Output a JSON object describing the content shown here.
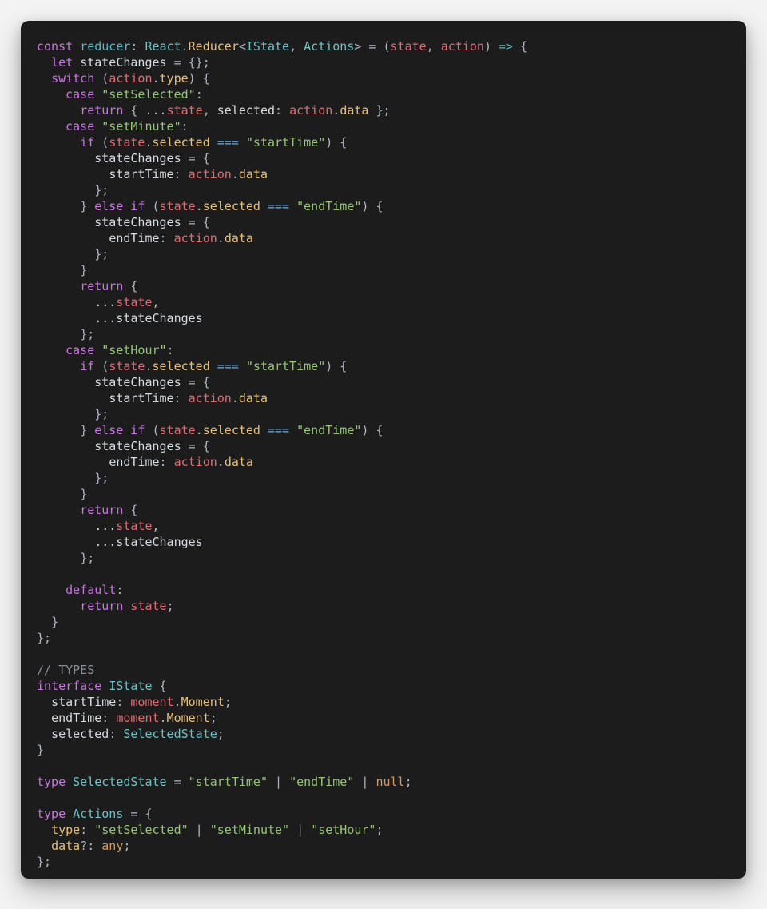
{
  "code": {
    "tokens": [
      [
        [
          "kw",
          "const"
        ],
        [
          "id",
          " "
        ],
        [
          "fn",
          "reducer"
        ],
        [
          "punc",
          ": "
        ],
        [
          "ty",
          "React"
        ],
        [
          "punc",
          "."
        ],
        [
          "prop",
          "Reducer"
        ],
        [
          "punc",
          "<"
        ],
        [
          "ty",
          "IState"
        ],
        [
          "punc",
          ", "
        ],
        [
          "ty",
          "Actions"
        ],
        [
          "punc",
          "> = ("
        ],
        [
          "mem",
          "state"
        ],
        [
          "punc",
          ", "
        ],
        [
          "mem",
          "action"
        ],
        [
          "punc",
          ") "
        ],
        [
          "fn",
          "=>"
        ],
        [
          "punc",
          " {"
        ]
      ],
      [
        [
          "id",
          "  "
        ],
        [
          "kw",
          "let"
        ],
        [
          "id",
          " "
        ],
        [
          "id",
          "stateChanges"
        ],
        [
          "punc",
          " = {};"
        ]
      ],
      [
        [
          "id",
          "  "
        ],
        [
          "kw",
          "switch"
        ],
        [
          "punc",
          " ("
        ],
        [
          "mem",
          "action"
        ],
        [
          "punc",
          "."
        ],
        [
          "prop",
          "type"
        ],
        [
          "punc",
          ") {"
        ]
      ],
      [
        [
          "id",
          "    "
        ],
        [
          "kw",
          "case"
        ],
        [
          "id",
          " "
        ],
        [
          "str",
          "\"setSelected\""
        ],
        [
          "punc",
          ":"
        ]
      ],
      [
        [
          "id",
          "      "
        ],
        [
          "kw",
          "return"
        ],
        [
          "punc",
          " { ..."
        ],
        [
          "mem",
          "state"
        ],
        [
          "punc",
          ", "
        ],
        [
          "id",
          "selected"
        ],
        [
          "punc",
          ": "
        ],
        [
          "mem",
          "action"
        ],
        [
          "punc",
          "."
        ],
        [
          "prop",
          "data"
        ],
        [
          "punc",
          " };"
        ]
      ],
      [
        [
          "id",
          "    "
        ],
        [
          "kw",
          "case"
        ],
        [
          "id",
          " "
        ],
        [
          "str",
          "\"setMinute\""
        ],
        [
          "punc",
          ":"
        ]
      ],
      [
        [
          "id",
          "      "
        ],
        [
          "kw",
          "if"
        ],
        [
          "punc",
          " ("
        ],
        [
          "mem",
          "state"
        ],
        [
          "punc",
          "."
        ],
        [
          "prop",
          "selected"
        ],
        [
          "punc",
          " "
        ],
        [
          "op",
          "==="
        ],
        [
          "punc",
          " "
        ],
        [
          "str",
          "\"startTime\""
        ],
        [
          "punc",
          ") {"
        ]
      ],
      [
        [
          "id",
          "        "
        ],
        [
          "id",
          "stateChanges"
        ],
        [
          "punc",
          " = {"
        ]
      ],
      [
        [
          "id",
          "          "
        ],
        [
          "id",
          "startTime"
        ],
        [
          "punc",
          ": "
        ],
        [
          "mem",
          "action"
        ],
        [
          "punc",
          "."
        ],
        [
          "prop",
          "data"
        ]
      ],
      [
        [
          "id",
          "        "
        ],
        [
          "punc",
          "};"
        ]
      ],
      [
        [
          "id",
          "      "
        ],
        [
          "punc",
          "} "
        ],
        [
          "kw",
          "else if"
        ],
        [
          "punc",
          " ("
        ],
        [
          "mem",
          "state"
        ],
        [
          "punc",
          "."
        ],
        [
          "prop",
          "selected"
        ],
        [
          "punc",
          " "
        ],
        [
          "op",
          "==="
        ],
        [
          "punc",
          " "
        ],
        [
          "str",
          "\"endTime\""
        ],
        [
          "punc",
          ") {"
        ]
      ],
      [
        [
          "id",
          "        "
        ],
        [
          "id",
          "stateChanges"
        ],
        [
          "punc",
          " = {"
        ]
      ],
      [
        [
          "id",
          "          "
        ],
        [
          "id",
          "endTime"
        ],
        [
          "punc",
          ": "
        ],
        [
          "mem",
          "action"
        ],
        [
          "punc",
          "."
        ],
        [
          "prop",
          "data"
        ]
      ],
      [
        [
          "id",
          "        "
        ],
        [
          "punc",
          "};"
        ]
      ],
      [
        [
          "id",
          "      "
        ],
        [
          "punc",
          "}"
        ]
      ],
      [
        [
          "id",
          "      "
        ],
        [
          "kw",
          "return"
        ],
        [
          "punc",
          " {"
        ]
      ],
      [
        [
          "id",
          "        ..."
        ],
        [
          "mem",
          "state"
        ],
        [
          "punc",
          ","
        ]
      ],
      [
        [
          "id",
          "        ..."
        ],
        [
          "id",
          "stateChanges"
        ]
      ],
      [
        [
          "id",
          "      "
        ],
        [
          "punc",
          "};"
        ]
      ],
      [
        [
          "id",
          "    "
        ],
        [
          "kw",
          "case"
        ],
        [
          "id",
          " "
        ],
        [
          "str",
          "\"setHour\""
        ],
        [
          "punc",
          ":"
        ]
      ],
      [
        [
          "id",
          "      "
        ],
        [
          "kw",
          "if"
        ],
        [
          "punc",
          " ("
        ],
        [
          "mem",
          "state"
        ],
        [
          "punc",
          "."
        ],
        [
          "prop",
          "selected"
        ],
        [
          "punc",
          " "
        ],
        [
          "op",
          "==="
        ],
        [
          "punc",
          " "
        ],
        [
          "str",
          "\"startTime\""
        ],
        [
          "punc",
          ") {"
        ]
      ],
      [
        [
          "id",
          "        "
        ],
        [
          "id",
          "stateChanges"
        ],
        [
          "punc",
          " = {"
        ]
      ],
      [
        [
          "id",
          "          "
        ],
        [
          "id",
          "startTime"
        ],
        [
          "punc",
          ": "
        ],
        [
          "mem",
          "action"
        ],
        [
          "punc",
          "."
        ],
        [
          "prop",
          "data"
        ]
      ],
      [
        [
          "id",
          "        "
        ],
        [
          "punc",
          "};"
        ]
      ],
      [
        [
          "id",
          "      "
        ],
        [
          "punc",
          "} "
        ],
        [
          "kw",
          "else if"
        ],
        [
          "punc",
          " ("
        ],
        [
          "mem",
          "state"
        ],
        [
          "punc",
          "."
        ],
        [
          "prop",
          "selected"
        ],
        [
          "punc",
          " "
        ],
        [
          "op",
          "==="
        ],
        [
          "punc",
          " "
        ],
        [
          "str",
          "\"endTime\""
        ],
        [
          "punc",
          ") {"
        ]
      ],
      [
        [
          "id",
          "        "
        ],
        [
          "id",
          "stateChanges"
        ],
        [
          "punc",
          " = {"
        ]
      ],
      [
        [
          "id",
          "          "
        ],
        [
          "id",
          "endTime"
        ],
        [
          "punc",
          ": "
        ],
        [
          "mem",
          "action"
        ],
        [
          "punc",
          "."
        ],
        [
          "prop",
          "data"
        ]
      ],
      [
        [
          "id",
          "        "
        ],
        [
          "punc",
          "};"
        ]
      ],
      [
        [
          "id",
          "      "
        ],
        [
          "punc",
          "}"
        ]
      ],
      [
        [
          "id",
          "      "
        ],
        [
          "kw",
          "return"
        ],
        [
          "punc",
          " {"
        ]
      ],
      [
        [
          "id",
          "        ..."
        ],
        [
          "mem",
          "state"
        ],
        [
          "punc",
          ","
        ]
      ],
      [
        [
          "id",
          "        ..."
        ],
        [
          "id",
          "stateChanges"
        ]
      ],
      [
        [
          "id",
          "      "
        ],
        [
          "punc",
          "};"
        ]
      ],
      [
        [
          "id",
          ""
        ]
      ],
      [
        [
          "id",
          "    "
        ],
        [
          "kw",
          "default"
        ],
        [
          "punc",
          ":"
        ]
      ],
      [
        [
          "id",
          "      "
        ],
        [
          "kw",
          "return"
        ],
        [
          "id",
          " "
        ],
        [
          "mem",
          "state"
        ],
        [
          "punc",
          ";"
        ]
      ],
      [
        [
          "id",
          "  "
        ],
        [
          "punc",
          "}"
        ]
      ],
      [
        [
          "punc",
          "};"
        ]
      ],
      [
        [
          "id",
          ""
        ]
      ],
      [
        [
          "cmt",
          "// TYPES"
        ]
      ],
      [
        [
          "kw",
          "interface"
        ],
        [
          "id",
          " "
        ],
        [
          "ty",
          "IState"
        ],
        [
          "punc",
          " {"
        ]
      ],
      [
        [
          "id",
          "  "
        ],
        [
          "id",
          "startTime"
        ],
        [
          "punc",
          ": "
        ],
        [
          "mem",
          "moment"
        ],
        [
          "punc",
          "."
        ],
        [
          "prop",
          "Moment"
        ],
        [
          "punc",
          ";"
        ]
      ],
      [
        [
          "id",
          "  "
        ],
        [
          "id",
          "endTime"
        ],
        [
          "punc",
          ": "
        ],
        [
          "mem",
          "moment"
        ],
        [
          "punc",
          "."
        ],
        [
          "prop",
          "Moment"
        ],
        [
          "punc",
          ";"
        ]
      ],
      [
        [
          "id",
          "  "
        ],
        [
          "id",
          "selected"
        ],
        [
          "punc",
          ": "
        ],
        [
          "ty",
          "SelectedState"
        ],
        [
          "punc",
          ";"
        ]
      ],
      [
        [
          "punc",
          "}"
        ]
      ],
      [
        [
          "id",
          ""
        ]
      ],
      [
        [
          "kw",
          "type"
        ],
        [
          "id",
          " "
        ],
        [
          "ty",
          "SelectedState"
        ],
        [
          "punc",
          " = "
        ],
        [
          "str",
          "\"startTime\""
        ],
        [
          "punc",
          " | "
        ],
        [
          "str",
          "\"endTime\""
        ],
        [
          "punc",
          " | "
        ],
        [
          "null",
          "null"
        ],
        [
          "punc",
          ";"
        ]
      ],
      [
        [
          "id",
          ""
        ]
      ],
      [
        [
          "kw",
          "type"
        ],
        [
          "id",
          " "
        ],
        [
          "ty",
          "Actions"
        ],
        [
          "punc",
          " = {"
        ]
      ],
      [
        [
          "id",
          "  "
        ],
        [
          "prop",
          "type"
        ],
        [
          "punc",
          ": "
        ],
        [
          "str",
          "\"setSelected\""
        ],
        [
          "punc",
          " | "
        ],
        [
          "str",
          "\"setMinute\""
        ],
        [
          "punc",
          " | "
        ],
        [
          "str",
          "\"setHour\""
        ],
        [
          "punc",
          ";"
        ]
      ],
      [
        [
          "id",
          "  "
        ],
        [
          "prop",
          "data"
        ],
        [
          "punc",
          "?: "
        ],
        [
          "null",
          "any"
        ],
        [
          "punc",
          ";"
        ]
      ],
      [
        [
          "punc",
          "};"
        ]
      ]
    ]
  }
}
